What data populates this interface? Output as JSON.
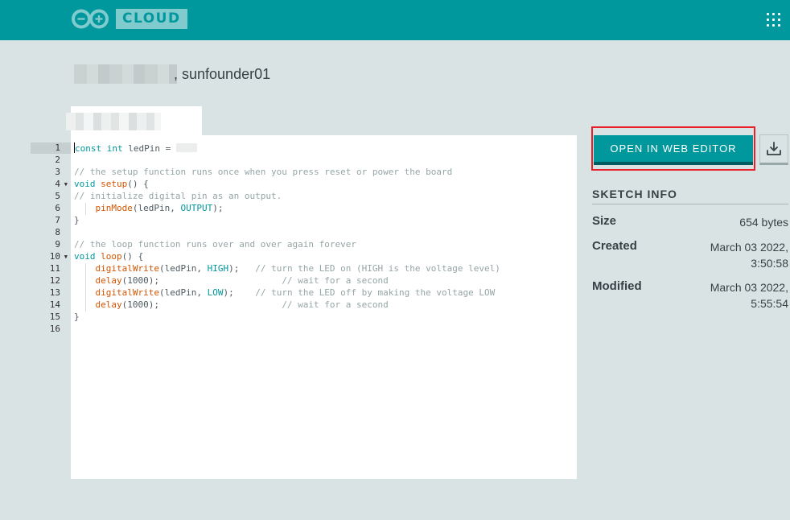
{
  "header": {
    "brand_badge": "CLOUD",
    "logo_icon": "arduino-infinity-logo-icon",
    "apps_icon": "apps-grid-icon",
    "colors": {
      "bar": "#00979d",
      "badge_bg": "#7fcbce",
      "badge_text": "#00979d"
    }
  },
  "sketch": {
    "owner": "sunfounder01"
  },
  "editor": {
    "lines": [
      {
        "n": "1",
        "fold": false,
        "html": "<span class=\"cur\"></span><span class=\"kw\">const</span> <span class=\"kw\">int</span> ledPin = <span class=\"val-blur\"></span>"
      },
      {
        "n": "2",
        "fold": false,
        "html": ""
      },
      {
        "n": "3",
        "fold": false,
        "html": "<span class=\"cm\">// the setup function runs once when you press reset or power the board</span>"
      },
      {
        "n": "4",
        "fold": true,
        "html": "<span class=\"kw\">void</span> <span class=\"fn\">setup</span>() {"
      },
      {
        "n": "5",
        "fold": false,
        "html": "<span class=\"cm\">// initialize digital pin as an output.</span>"
      },
      {
        "n": "6",
        "fold": false,
        "html": "<span class=\"indent-guide\"></span>    <span class=\"fn\">pinMode</span>(ledPin, <span class=\"kw\">OUTPUT</span>);"
      },
      {
        "n": "7",
        "fold": false,
        "html": "}"
      },
      {
        "n": "8",
        "fold": false,
        "html": ""
      },
      {
        "n": "9",
        "fold": false,
        "html": "<span class=\"cm\">// the loop function runs over and over again forever</span>"
      },
      {
        "n": "10",
        "fold": true,
        "html": "<span class=\"kw\">void</span> <span class=\"fn\">loop</span>() {"
      },
      {
        "n": "11",
        "fold": false,
        "html": "<span class=\"indent-guide\"></span>    <span class=\"fn\">digitalWrite</span>(ledPin, <span class=\"kw\">HIGH</span>);   <span class=\"cm\">// turn the LED on (HIGH is the voltage level)</span>"
      },
      {
        "n": "12",
        "fold": false,
        "html": "<span class=\"indent-guide\"></span>    <span class=\"fn\">delay</span>(1000);                       <span class=\"cm\">// wait for a second</span>"
      },
      {
        "n": "13",
        "fold": false,
        "html": "<span class=\"indent-guide\"></span>    <span class=\"fn\">digitalWrite</span>(ledPin, <span class=\"kw\">LOW</span>);    <span class=\"cm\">// turn the LED off by making the voltage LOW</span>"
      },
      {
        "n": "14",
        "fold": false,
        "html": "<span class=\"indent-guide\"></span>    <span class=\"fn\">delay</span>(1000);                       <span class=\"cm\">// wait for a second</span>"
      },
      {
        "n": "15",
        "fold": false,
        "html": "}"
      },
      {
        "n": "16",
        "fold": false,
        "html": ""
      }
    ],
    "colors": {
      "keyword": "#00979c",
      "function": "#d35400",
      "comment": "#95a5a6"
    }
  },
  "actions": {
    "open_web_editor": "OPEN IN WEB EDITOR",
    "download_icon": "download-icon"
  },
  "info": {
    "title": "SKETCH INFO",
    "size_label": "Size",
    "size_value": "654 bytes",
    "created_label": "Created",
    "created_date": "March 03 2022,",
    "created_time": "3:50:58",
    "modified_label": "Modified",
    "modified_date": "March 03 2022,",
    "modified_time": "5:55:54"
  }
}
